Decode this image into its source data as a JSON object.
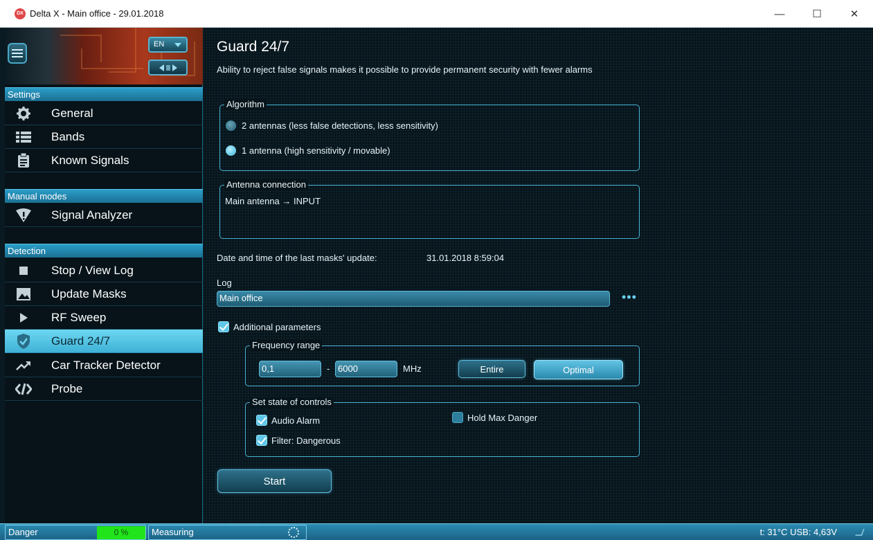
{
  "window": {
    "icon_text": "DX",
    "title": "Delta X - Main office - 29.01.2018",
    "minimize": "—",
    "maximize": "☐",
    "close": "✕"
  },
  "sidebar": {
    "language": "EN",
    "sections": {
      "settings": "Settings",
      "manual": "Manual modes",
      "detection": "Detection"
    },
    "items": {
      "general": "General",
      "bands": "Bands",
      "known_signals": "Known Signals",
      "signal_analyzer": "Signal Analyzer",
      "stop_view_log": "Stop / View Log",
      "update_masks": "Update Masks",
      "rf_sweep": "RF Sweep",
      "guard": "Guard 24/7",
      "car_tracker": "Car Tracker Detector",
      "probe": "Probe"
    },
    "active_item": "guard"
  },
  "main": {
    "title": "Guard 24/7",
    "description": "Ability to reject false signals makes it possible to provide permanent security with fewer alarms",
    "algorithm": {
      "title": "Algorithm",
      "option1": "2 antennas (less false detections, less sensitivity)",
      "option2": "1 antenna (high sensitivity / movable)",
      "selected": "option2"
    },
    "antenna": {
      "title": "Antenna connection",
      "text": "Main antenna → INPUT"
    },
    "masks_update": {
      "label": "Date and time of the last masks' update:",
      "value": "31.01.2018 8:59:04"
    },
    "log": {
      "label": "Log",
      "value": "Main office",
      "more": "•••"
    },
    "additional": {
      "label": "Additional parameters",
      "checked": true
    },
    "frequency": {
      "title": "Frequency range",
      "from": "0,1",
      "dash": "-",
      "to": "6000",
      "unit": "MHz",
      "entire": "Entire",
      "optimal": "Optimal"
    },
    "controls": {
      "title": "Set state of controls",
      "audio_alarm": "Audio Alarm",
      "filter_dangerous": "Filter: Dangerous",
      "hold_max_danger": "Hold Max Danger",
      "audio_alarm_checked": true,
      "filter_dangerous_checked": true,
      "hold_max_danger_checked": false
    },
    "start": "Start"
  },
  "statusbar": {
    "danger_label": "Danger",
    "danger_value": "0 %",
    "danger_level": 0,
    "measuring": "Measuring",
    "temp_usb": "t: 31°C  USB: 4,63V"
  },
  "colors": {
    "accent": "#49b2d4",
    "active_item": "#6dd7f2",
    "danger_meter": "#22e41b",
    "close_icon_bg": "#e04848"
  }
}
